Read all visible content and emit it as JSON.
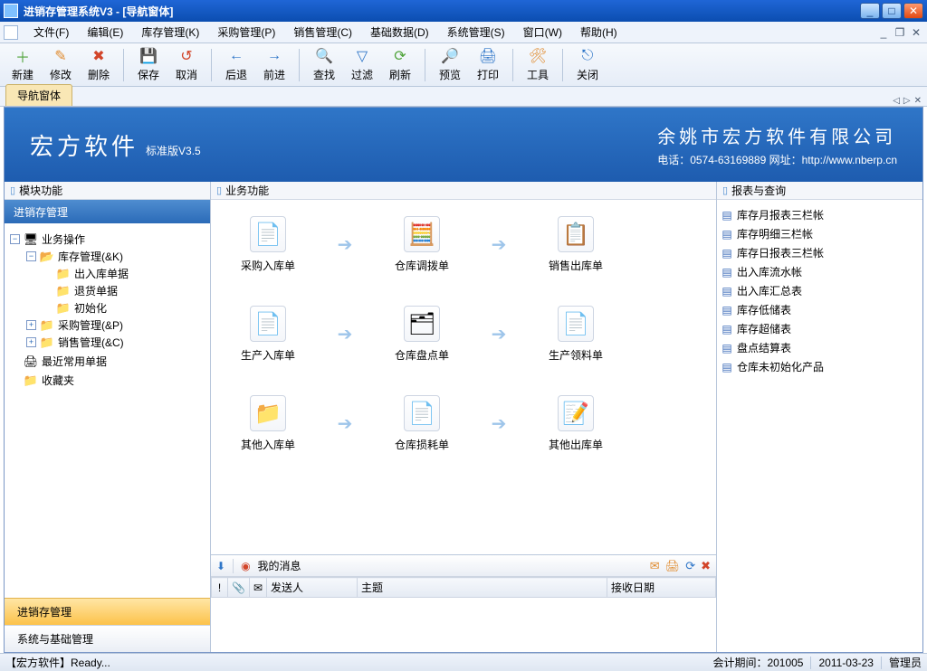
{
  "window": {
    "title": "进销存管理系统V3 - [导航窗体]"
  },
  "menus": [
    {
      "label": "文件(F)"
    },
    {
      "label": "编辑(E)"
    },
    {
      "label": "库存管理(K)"
    },
    {
      "label": "采购管理(P)"
    },
    {
      "label": "销售管理(C)"
    },
    {
      "label": "基础数据(D)"
    },
    {
      "label": "系统管理(S)"
    },
    {
      "label": "窗口(W)"
    },
    {
      "label": "帮助(H)"
    }
  ],
  "toolbar": [
    {
      "label": "新建",
      "icon": "＋",
      "color": "c-green"
    },
    {
      "label": "修改",
      "icon": "✎",
      "color": "c-orange"
    },
    {
      "label": "删除",
      "icon": "✖",
      "color": "c-red"
    },
    {
      "sep": true
    },
    {
      "label": "保存",
      "icon": "💾",
      "color": "c-blue"
    },
    {
      "label": "取消",
      "icon": "↺",
      "color": "c-red"
    },
    {
      "sep": true
    },
    {
      "label": "后退",
      "icon": "←",
      "color": "c-blue"
    },
    {
      "label": "前进",
      "icon": "→",
      "color": "c-blue"
    },
    {
      "sep": true
    },
    {
      "label": "查找",
      "icon": "🔍",
      "color": "c-blue"
    },
    {
      "label": "过滤",
      "icon": "▽",
      "color": "c-blue"
    },
    {
      "label": "刷新",
      "icon": "⟳",
      "color": "c-green"
    },
    {
      "sep": true
    },
    {
      "label": "预览",
      "icon": "🔎",
      "color": "c-blue"
    },
    {
      "label": "打印",
      "icon": "🖨",
      "color": "c-blue"
    },
    {
      "sep": true
    },
    {
      "label": "工具",
      "icon": "🛠",
      "color": "c-orange"
    },
    {
      "sep": true
    },
    {
      "label": "关闭",
      "icon": "⎋",
      "color": "c-blue"
    }
  ],
  "tab": {
    "label": "导航窗体"
  },
  "banner": {
    "brand": "宏方软件",
    "subver": "标准版V3.5",
    "company": "余姚市宏方软件有限公司",
    "contact": "电话：0574-63169889   网址：http://www.nberp.cn"
  },
  "sidebar": {
    "section": "模块功能",
    "title": "进销存管理",
    "buttons": [
      {
        "label": "进销存管理",
        "active": true
      },
      {
        "label": "系统与基础管理",
        "active": false
      }
    ],
    "tree": {
      "root": "业务操作",
      "nodes": [
        {
          "label": "库存管理(&K)",
          "expanded": true,
          "children": [
            {
              "label": "出入库单据"
            },
            {
              "label": "退货单据"
            },
            {
              "label": "初始化"
            }
          ]
        },
        {
          "label": "采购管理(&P)",
          "expanded": false
        },
        {
          "label": "销售管理(&C)",
          "expanded": false
        }
      ],
      "extra": [
        {
          "label": "最近常用单据",
          "icon": "doc"
        },
        {
          "label": "收藏夹",
          "icon": "folder"
        }
      ]
    }
  },
  "center": {
    "section": "业务功能",
    "rows": [
      {
        "items": [
          {
            "label": "采购入库单",
            "icon": "📄",
            "arrow": true
          },
          {
            "label": "仓库调拨单",
            "icon": "🧮",
            "arrow": true
          },
          {
            "label": "销售出库单",
            "icon": "📋"
          }
        ]
      },
      {
        "items": [
          {
            "label": "生产入库单",
            "icon": "📄",
            "arrow": true
          },
          {
            "label": "仓库盘点单",
            "icon": "🗂",
            "arrow": true
          },
          {
            "label": "生产领料单",
            "icon": "📄"
          }
        ]
      },
      {
        "items": [
          {
            "label": "其他入库单",
            "icon": "📁",
            "arrow": true
          },
          {
            "label": "仓库损耗单",
            "icon": "📄",
            "arrow": true
          },
          {
            "label": "其他出库单",
            "icon": "📝"
          }
        ]
      }
    ]
  },
  "reports": {
    "section": "报表与查询",
    "items": [
      "库存月报表三栏帐",
      "库存明细三栏帐",
      "库存日报表三栏帐",
      "出入库流水帐",
      "出入库汇总表",
      "库存低储表",
      "库存超储表",
      "盘点结算表",
      "仓库未初始化产品"
    ]
  },
  "messages": {
    "label": "我的消息",
    "cols": {
      "c1": "!",
      "c2": "📎",
      "c3": "✉",
      "sender": "发送人",
      "subject": "主题",
      "recvdate": "接收日期"
    }
  },
  "status": {
    "brand": "【宏方软件】",
    "ready": "Ready...",
    "period": "会计期间：201005",
    "date": "2011-03-23",
    "user": "管理员"
  }
}
